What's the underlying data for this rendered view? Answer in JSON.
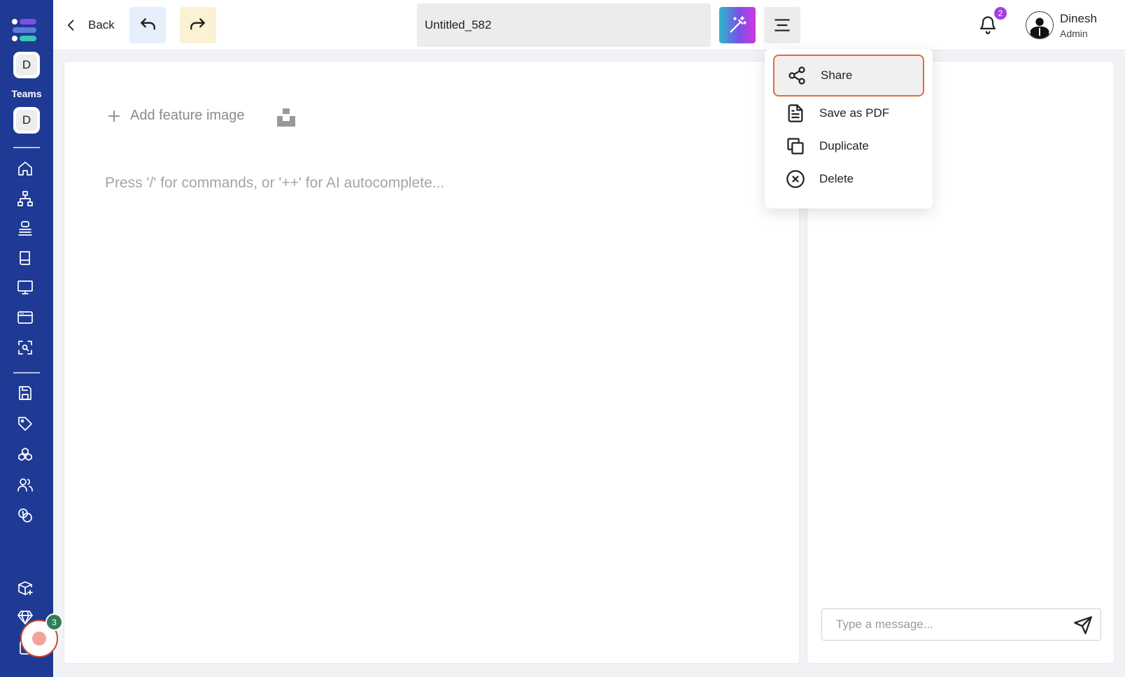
{
  "sidebar": {
    "team_initial_1": "D",
    "team_initial_2": "D",
    "teams_label": "Teams",
    "icons": [
      "home-icon",
      "sitemap-icon",
      "stack-icon",
      "book-icon",
      "monitor-icon",
      "browser-window-icon",
      "scan-search-icon",
      "save-icon",
      "tag-icon",
      "cubes-icon",
      "users-icon",
      "coins-icon",
      "package-add-icon",
      "diamond-icon",
      "clipboard-icon"
    ],
    "record_badge": "3"
  },
  "header": {
    "back_label": "Back",
    "doc_title": "Untitled_582",
    "notification_count": "2",
    "user_name": "Dinesh",
    "user_role": "Admin"
  },
  "editor": {
    "add_feature_label": "Add feature image",
    "placeholder": "Press '/' for commands, or '++' for AI autocomplete..."
  },
  "chat": {
    "placeholder": "Type a message..."
  },
  "menu": {
    "items": [
      {
        "label": "Share",
        "icon": "share-icon"
      },
      {
        "label": "Save as PDF",
        "icon": "document-icon"
      },
      {
        "label": "Duplicate",
        "icon": "duplicate-icon"
      },
      {
        "label": "Delete",
        "icon": "delete-circle-icon"
      }
    ]
  },
  "colors": {
    "sidebar_bg": "#1e3a94",
    "highlight_border": "#e26a3d",
    "badge_purple": "#a43fe0",
    "badge_green": "#2f7d5a"
  }
}
